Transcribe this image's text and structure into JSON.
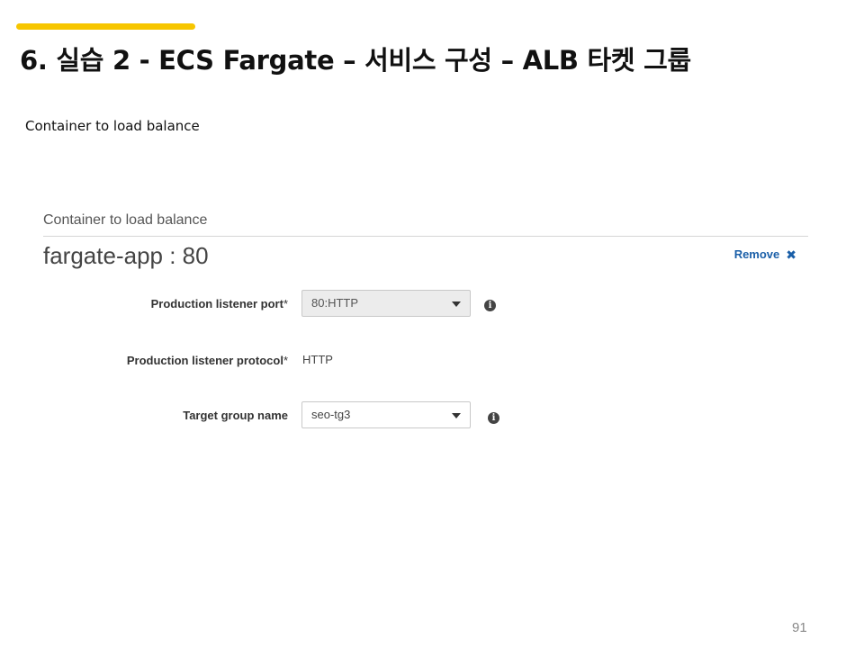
{
  "colors": {
    "accent_bar": "#f7c600",
    "link": "#1a5fa8"
  },
  "slide": {
    "title": "6. 실습 2 - ECS Fargate – 서비스 구성 – ALB 타켓 그룹",
    "subtitle": "Container to load balance",
    "page_number": "91"
  },
  "panel": {
    "label": "Container to load balance",
    "container_name": "fargate-app : 80",
    "remove_label": "Remove",
    "remove_icon": "close-x-icon",
    "fields": {
      "listener_port": {
        "label": "Production listener port",
        "required": "*",
        "value": "80:HTTP",
        "disabled": true,
        "info_icon": "info-icon"
      },
      "listener_protocol": {
        "label": "Production listener protocol",
        "required": "*",
        "value": "HTTP"
      },
      "target_group": {
        "label": "Target group name",
        "value": "seo-tg3",
        "info_icon": "info-icon"
      }
    }
  }
}
